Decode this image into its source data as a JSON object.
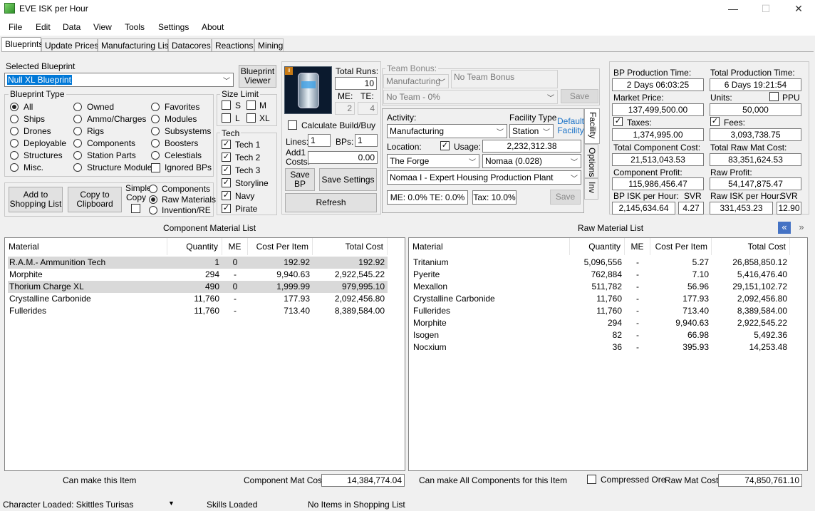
{
  "window": {
    "title": "EVE ISK per Hour",
    "min": "—",
    "max": "☐",
    "close": "✕"
  },
  "menu": [
    "File",
    "Edit",
    "Data",
    "View",
    "Tools",
    "Settings",
    "About"
  ],
  "tabs": [
    "Blueprints",
    "Update Prices",
    "Manufacturing List",
    "Datacores",
    "Reactions",
    "Mining"
  ],
  "selected_blueprint": {
    "label": "Selected Blueprint",
    "value": "Null XL Blueprint",
    "viewer_button": "Blueprint Viewer"
  },
  "blueprint_type": {
    "title": "Blueprint Type",
    "options": [
      {
        "label": "All",
        "on": true
      },
      {
        "label": "Ships",
        "on": false
      },
      {
        "label": "Drones",
        "on": false
      },
      {
        "label": "Deployable",
        "on": false
      },
      {
        "label": "Structures",
        "on": false
      },
      {
        "label": "Misc.",
        "on": false
      },
      {
        "label": "Owned",
        "on": false
      },
      {
        "label": "Ammo/Charges",
        "on": false
      },
      {
        "label": "Rigs",
        "on": false
      },
      {
        "label": "Components",
        "on": false
      },
      {
        "label": "Station Parts",
        "on": false
      },
      {
        "label": "Structure Modules",
        "on": false
      },
      {
        "label": "Favorites",
        "on": false
      },
      {
        "label": "Modules",
        "on": false
      },
      {
        "label": "Subsystems",
        "on": false
      },
      {
        "label": "Boosters",
        "on": false
      },
      {
        "label": "Celestials",
        "on": false
      },
      {
        "label": "Ignored BPs",
        "on": false,
        "check": true
      }
    ]
  },
  "size_limit": {
    "title": "Size Limit",
    "s": "S",
    "m": "M",
    "l": "L",
    "xl": "XL"
  },
  "tech": {
    "title": "Tech",
    "items": [
      "Tech 1",
      "Tech 2",
      "Tech 3",
      "Storyline",
      "Navy",
      "Pirate"
    ]
  },
  "actions": {
    "add_shopping": "Add to Shopping List",
    "copy_clipboard": "Copy to Clipboard",
    "simple_copy": "Simple Copy",
    "components": "Components",
    "raw_materials": "Raw Materials",
    "invention": "Invention/RE"
  },
  "runs": {
    "total_runs_label": "Total Runs:",
    "total_runs": "10",
    "me_label": "ME:",
    "te_label": "TE:",
    "me": "2",
    "te": "4",
    "calc_build": "Calculate Build/Buy",
    "lines_label": "Lines:",
    "lines": "1",
    "bps_label": "BPs:",
    "bps": "1",
    "add_costs_label": "Add1 Costs:",
    "add_costs": "0.00",
    "save_bp": "Save BP",
    "save_settings": "Save Settings",
    "refresh": "Refresh"
  },
  "team": {
    "label": "Team Bonus:",
    "activity": "Manufacturing",
    "no_bonus": "No Team Bonus",
    "team": "No Team - 0%",
    "save": "Save"
  },
  "facility": {
    "activity_label": "Activity:",
    "activity": "Manufacturing",
    "type_label": "Facility Type",
    "type": "Station",
    "default_link": "Default Facility",
    "location_label": "Location:",
    "usage_label": "Usage:",
    "usage": "2,232,312.38",
    "region": "The Forge",
    "system": "Nomaa (0.028)",
    "station": "Nomaa I - Expert Housing Production Plant",
    "me_te": "ME: 0.0% TE: 0.0%",
    "tax": "Tax: 10.0%",
    "save": "Save",
    "side_tabs": [
      "Facility",
      "Options",
      "Inv"
    ]
  },
  "stats": {
    "bp_time_label": "BP Production Time:",
    "bp_time": "2 Days 06:03:25",
    "total_time_label": "Total Production Time:",
    "total_time": "6 Days 19:21:54",
    "market_label": "Market Price:",
    "market": "137,499,500.00",
    "units_label": "Units:",
    "ppu": "PPU",
    "units": "50,000",
    "taxes_label": "Taxes:",
    "taxes": "1,374,995.00",
    "fees_label": "Fees:",
    "fees": "3,093,738.75",
    "comp_cost_label": "Total Component Cost:",
    "comp_cost": "21,513,043.53",
    "raw_cost_label": "Total Raw Mat Cost:",
    "raw_cost": "83,351,624.53",
    "comp_profit_label": "Component Profit:",
    "comp_profit": "115,986,456.47",
    "raw_profit_label": "Raw Profit:",
    "raw_profit": "54,147,875.47",
    "bp_isk_label": "BP ISK per Hour:",
    "svr_label": "SVR",
    "bp_isk": "2,145,634.64",
    "bp_svr": "4.27",
    "raw_isk_label": "Raw ISK per Hour:",
    "raw_isk": "331,453.23",
    "raw_svr": "12.90"
  },
  "component_list": {
    "title": "Component Material List",
    "headers": [
      "Material",
      "Quantity",
      "ME",
      "Cost Per Item",
      "Total Cost"
    ],
    "rows": [
      [
        "R.A.M.- Ammunition Tech",
        "1",
        "0",
        "192.92",
        "192.92"
      ],
      [
        "Morphite",
        "294",
        "-",
        "9,940.63",
        "2,922,545.22"
      ],
      [
        "Thorium Charge XL",
        "490",
        "0",
        "1,999.99",
        "979,995.10"
      ],
      [
        "Crystalline Carbonide",
        "11,760",
        "-",
        "177.93",
        "2,092,456.80"
      ],
      [
        "Fullerides",
        "11,760",
        "-",
        "713.40",
        "8,389,584.00"
      ]
    ],
    "highlight": [
      0,
      2
    ],
    "footer_left": "Can make this Item",
    "footer_cost_label": "Component Mat Cost:",
    "footer_cost": "14,384,774.04"
  },
  "raw_list": {
    "title": "Raw Material List",
    "headers": [
      "Material",
      "Quantity",
      "ME",
      "Cost Per Item",
      "Total Cost"
    ],
    "rows": [
      [
        "Tritanium",
        "5,096,556",
        "-",
        "5.27",
        "26,858,850.12"
      ],
      [
        "Pyerite",
        "762,884",
        "-",
        "7.10",
        "5,416,476.40"
      ],
      [
        "Mexallon",
        "511,782",
        "-",
        "56.96",
        "29,151,102.72"
      ],
      [
        "Crystalline Carbonide",
        "11,760",
        "-",
        "177.93",
        "2,092,456.80"
      ],
      [
        "Fullerides",
        "11,760",
        "-",
        "713.40",
        "8,389,584.00"
      ],
      [
        "Morphite",
        "294",
        "-",
        "9,940.63",
        "2,922,545.22"
      ],
      [
        "Isogen",
        "82",
        "-",
        "66.98",
        "5,492.36"
      ],
      [
        "Nocxium",
        "36",
        "-",
        "395.93",
        "14,253.48"
      ]
    ],
    "footer_left": "Can make All Components for this Item",
    "compressed": "Compressed Ore",
    "footer_cost_label": "Raw Mat Cost:",
    "footer_cost": "74,850,761.10"
  },
  "status": {
    "character": "Character Loaded: Skittles Turisas",
    "skills": "Skills Loaded",
    "shopping": "No Items in Shopping List"
  }
}
